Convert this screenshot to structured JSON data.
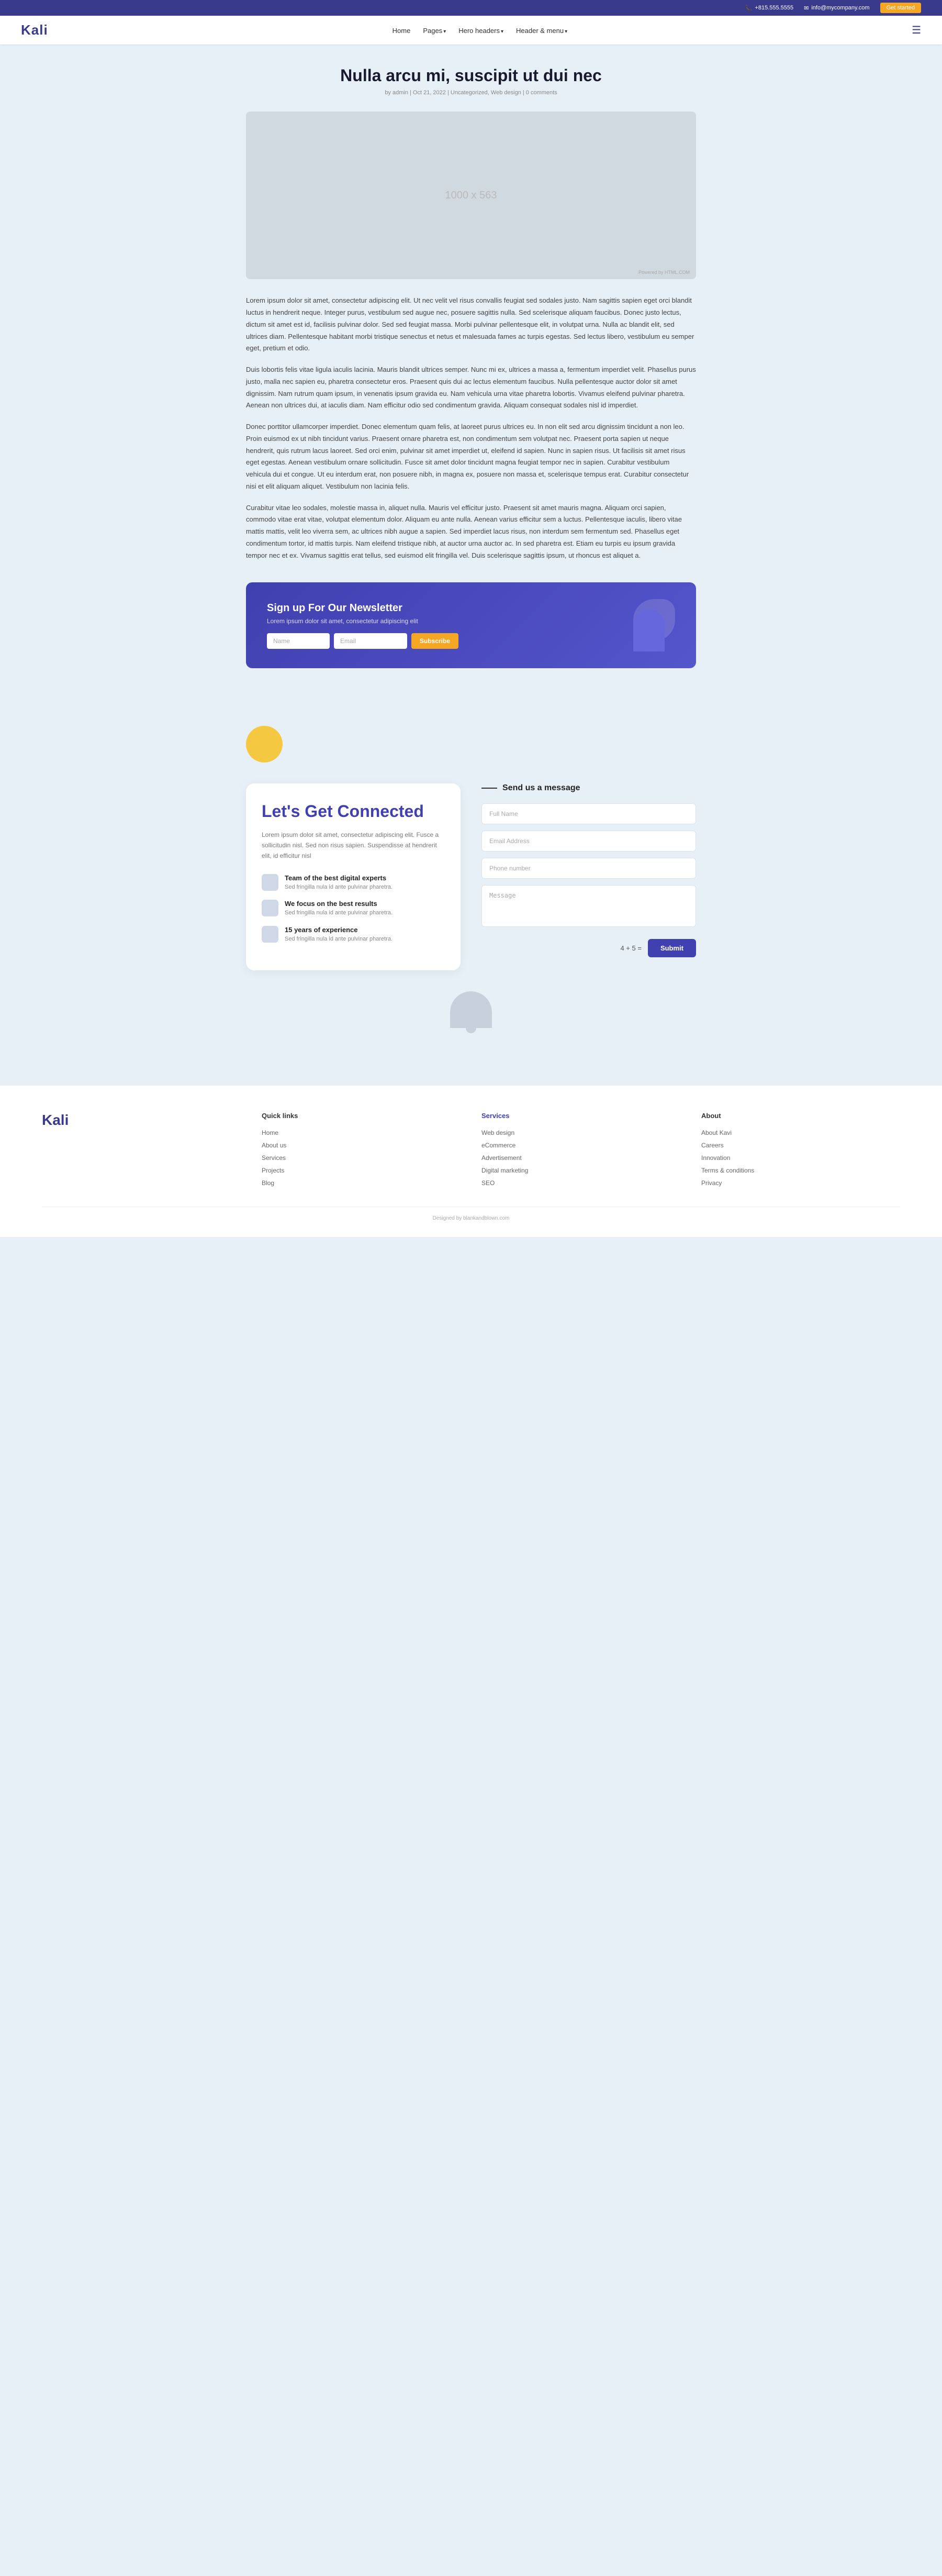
{
  "topbar": {
    "phone": "+815.555.5555",
    "email": "info@mycompany.com",
    "cta": "Get started",
    "phone_icon": "phone-icon",
    "email_icon": "email-icon"
  },
  "navbar": {
    "logo": "Kali",
    "links": [
      {
        "label": "Home",
        "has_dropdown": false
      },
      {
        "label": "Pages",
        "has_dropdown": true
      },
      {
        "label": "Hero headers",
        "has_dropdown": true
      },
      {
        "label": "Header & menu",
        "has_dropdown": true
      }
    ],
    "menu_icon": "hamburger-icon"
  },
  "post": {
    "title": "Nulla arcu mi, suscipit ut dui nec",
    "meta": "by admin | Oct 21, 2022 | Uncategorized, Web design | 0 comments",
    "image_placeholder": "1000 x 563",
    "image_powered": "Powered by HTML.COM",
    "body_paragraphs": [
      "Lorem ipsum dolor sit amet, consectetur adipiscing elit. Ut nec velit vel risus convallis feugiat sed sodales justo. Nam sagittis sapien eget orci blandit luctus in hendrerit neque. Integer purus, vestibulum sed augue nec, posuere sagittis nulla. Sed scelerisque aliquam faucibus. Donec justo lectus, dictum sit amet est id, facilisis pulvinar dolor. Sed sed feugiat massa. Morbi pulvinar pellentesque elit, in volutpat urna. Nulla ac blandit elit, sed ultrices diam. Pellentesque habitant morbi tristique senectus et netus et malesuada fames ac turpis egestas. Sed lectus libero, vestibulum eu semper eget, pretium et odio.",
      "Duis lobortis felis vitae ligula iaculis lacinia. Mauris blandit ultrices semper. Nunc mi ex, ultrices a massa a, fermentum imperdiet velit. Phasellus purus justo, malla nec sapien eu, pharetra consectetur eros. Praesent quis dui ac lectus elementum faucibus. Nulla pellentesque auctor dolor sit amet dignissim. Nam rutrum quam ipsum, in venenatis ipsum gravida eu. Nam vehicula urna vitae pharetra lobortis. Vivamus eleifend pulvinar pharetra. Aenean non ultrices dui, at iaculis diam. Nam efficitur odio sed condimentum gravida. Aliquam consequat sodales nisl id imperdiet.",
      "Donec porttitor ullamcorper imperdiet. Donec elementum quam felis, at laoreet purus ultrices eu. In non elit sed arcu dignissim tincidunt a non leo. Proin euismod ex ut nibh tincidunt varius. Praesent ornare pharetra est, non condimentum sem volutpat nec. Praesent porta sapien ut neque hendrerit, quis rutrum lacus laoreet. Sed orci enim, pulvinar sit amet imperdiet ut, eleifend id sapien. Nunc in sapien risus. Ut facilisis sit amet risus eget egestas. Aenean vestibulum ornare sollicitudin. Fusce sit amet dolor tincidunt magna feugiat tempor nec in sapien. Curabitur vestibulum vehicula dui et congue. Ut eu interdum erat, non posuere nibh, in magna ex, posuere non massa et, scelerisque tempus erat. Curabitur consectetur nisi et elit aliquam aliquet. Vestibulum non lacinia felis.",
      "Curabitur vitae leo sodales, molestie massa in, aliquet nulla. Mauris vel efficitur justo. Praesent sit amet mauris magna. Aliquam orci sapien, commodo vitae erat vitae, volutpat elementum dolor. Aliquam eu ante nulla. Aenean varius efficitur sem a luctus. Pellentesque iaculis, libero vitae mattis mattis, velit leo viverra sem, ac ultrices nibh augue a sapien. Sed imperdiet lacus risus, non interdum sem fermentum sed. Phasellus eget condimentum tortor, id mattis turpis. Nam eleifend tristique nibh, at auctor urna auctor ac. In sed pharetra est. Etiam eu turpis eu ipsum gravida tempor nec et ex. Vivamus sagittis erat tellus, sed euismod elit fringilla vel. Duis scelerisque sagittis ipsum, ut rhoncus est aliquet a."
    ]
  },
  "newsletter": {
    "title": "Sign up For Our Newsletter",
    "description": "Lorem ipsum dolor sit amet, consectetur adipiscing elit",
    "name_placeholder": "Name",
    "email_placeholder": "Email",
    "subscribe_label": "Subscribe"
  },
  "connect": {
    "title": "Let's Get Connected",
    "description": "Lorem ipsum dolor sit amet, consectetur adipiscing elit. Fusce a sollicitudin nisl. Sed non risus sapien. Suspendisse at hendrerit elit, id efficitur nisl",
    "features": [
      {
        "title": "Team of the best digital experts",
        "subtitle": "Sed fringilla nula id ante pulvinar pharetra."
      },
      {
        "title": "We focus on the best results",
        "subtitle": "Sed fringilla nula id ante pulvinar pharetra."
      },
      {
        "title": "15 years of experience",
        "subtitle": "Sed fringilla nula id ante pulvinar pharetra."
      }
    ]
  },
  "contact_form": {
    "header_line": "",
    "header_title": "Send us a message",
    "full_name_placeholder": "Full Name",
    "email_placeholder": "Email Address",
    "phone_placeholder": "Phone number",
    "message_placeholder": "Message",
    "captcha": "4 + 5 =",
    "submit_label": "Submit"
  },
  "footer": {
    "logo": "Kali",
    "quick_links_title": "Quick links",
    "quick_links": [
      {
        "label": "Home"
      },
      {
        "label": "About us"
      },
      {
        "label": "Services"
      },
      {
        "label": "Projects"
      },
      {
        "label": "Blog"
      }
    ],
    "services_title": "Services",
    "services_links": [
      {
        "label": "Web design"
      },
      {
        "label": "eCommerce"
      },
      {
        "label": "Advertisement"
      },
      {
        "label": "Digital marketing"
      },
      {
        "label": "SEO"
      }
    ],
    "about_title": "About",
    "about_links": [
      {
        "label": "About Kavi"
      },
      {
        "label": "Careers"
      },
      {
        "label": "Innovation"
      },
      {
        "label": "Terms & conditions"
      },
      {
        "label": "Privacy"
      }
    ],
    "copyright": "Designed by blankandblown.com"
  }
}
